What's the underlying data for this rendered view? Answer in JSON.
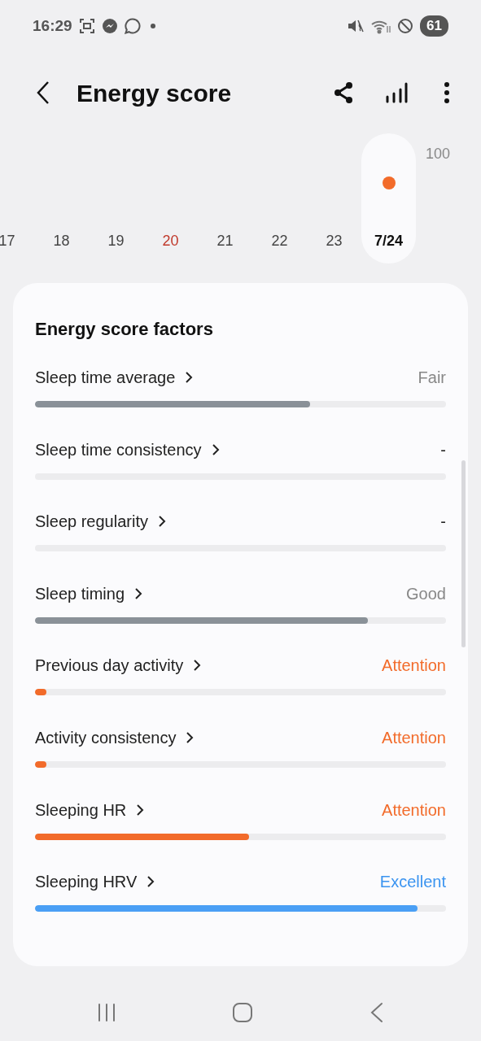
{
  "status_bar": {
    "time": "16:29",
    "battery": "61"
  },
  "header": {
    "title": "Energy score"
  },
  "chart": {
    "y_label": "100",
    "days": [
      {
        "label": "17",
        "selected": false,
        "has_score": false,
        "color": "#444444"
      },
      {
        "label": "18",
        "selected": false,
        "has_score": false,
        "color": "#444444"
      },
      {
        "label": "19",
        "selected": false,
        "has_score": false,
        "color": "#444444"
      },
      {
        "label": "20",
        "selected": false,
        "has_score": false,
        "color": "#c0392b"
      },
      {
        "label": "21",
        "selected": false,
        "has_score": false,
        "color": "#444444"
      },
      {
        "label": "22",
        "selected": false,
        "has_score": false,
        "color": "#444444"
      },
      {
        "label": "23",
        "selected": false,
        "has_score": false,
        "color": "#444444"
      },
      {
        "label": "7/24",
        "selected": true,
        "has_score": true,
        "color": "#111111"
      }
    ]
  },
  "factors_card": {
    "title": "Energy score factors",
    "factors": [
      {
        "name": "Sleep time average",
        "status": "Fair",
        "kind": "neutral",
        "level": 0.67
      },
      {
        "name": "Sleep time consistency",
        "status": "-",
        "kind": "none"
      },
      {
        "name": "Sleep regularity",
        "status": "-",
        "kind": "none"
      },
      {
        "name": "Sleep timing",
        "status": "Good",
        "kind": "neutral",
        "level": 0.81
      },
      {
        "name": "Previous day activity",
        "status": "Attention",
        "kind": "attention",
        "level": 0.027
      },
      {
        "name": "Activity consistency",
        "status": "Attention",
        "kind": "attention",
        "level": 0.027
      },
      {
        "name": "Sleeping HR",
        "status": "Attention",
        "kind": "attention",
        "level": 0.52
      },
      {
        "name": "Sleeping HRV",
        "status": "Excellent",
        "kind": "excellent",
        "level": 0.93
      }
    ]
  }
}
